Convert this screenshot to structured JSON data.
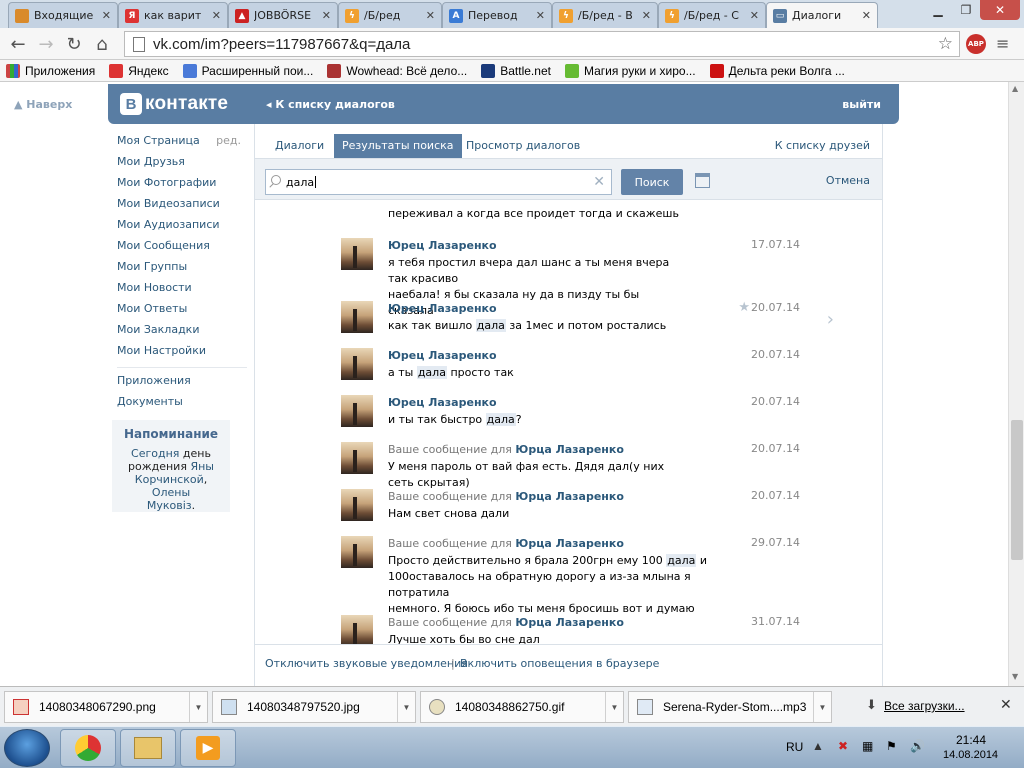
{
  "browser": {
    "tabs": [
      {
        "label": "Входящие",
        "color": "#d98a2b"
      },
      {
        "label": "как варит",
        "color": "#d33"
      },
      {
        "label": "JOBBÖRSE",
        "color": "#c22"
      },
      {
        "label": "/Б/ред",
        "color": "#f0a030"
      },
      {
        "label": "Перевод",
        "color": "#3a7bd5"
      },
      {
        "label": "/Б/ред - В",
        "color": "#f0a030"
      },
      {
        "label": "/Б/ред - С",
        "color": "#f0a030"
      },
      {
        "label": "Диалоги",
        "color": "#597da3"
      }
    ],
    "url": "vk.com/im?peers=117987667&q=дала",
    "abp": "ABP",
    "bookmarks": [
      {
        "label": "Приложения",
        "color": "#c44"
      },
      {
        "label": "Яндекс",
        "color": "#d33"
      },
      {
        "label": "Расширенный пои...",
        "color": "#4a7ad8"
      },
      {
        "label": "Wowhead: Всё дело...",
        "color": "#a33"
      },
      {
        "label": "Battle.net",
        "color": "#1a3a7a"
      },
      {
        "label": "Магия руки и хиро...",
        "color": "#6b3"
      },
      {
        "label": "Дельта реки Волга ...",
        "color": "#c11"
      }
    ]
  },
  "vk": {
    "naverh": "Наверх",
    "logo": "контакте",
    "logo_letter": "В",
    "back": "К списку диалогов",
    "logout": "выйти",
    "menu": [
      {
        "label": "Моя Страница",
        "extra": "ред."
      },
      {
        "label": "Мои Друзья"
      },
      {
        "label": "Мои Фотографии"
      },
      {
        "label": "Мои Видеозаписи"
      },
      {
        "label": "Мои Аудиозаписи"
      },
      {
        "label": "Мои Сообщения"
      },
      {
        "label": "Мои Группы"
      },
      {
        "label": "Мои Новости"
      },
      {
        "label": "Мои Ответы"
      },
      {
        "label": "Мои Закладки"
      },
      {
        "label": "Мои Настройки"
      }
    ],
    "menu2": [
      {
        "label": "Приложения"
      },
      {
        "label": "Документы"
      }
    ],
    "reminder": {
      "title": "Напоминание",
      "today": "Сегодня",
      "text1": "день",
      "text2": "рождения",
      "name1a": "Яны",
      "name1b": "Корчинской",
      "sep": ",",
      "name2a": "Олены",
      "name2b": "Муковіз",
      "end": "."
    },
    "tabs": [
      "Диалоги",
      "Результаты поиска",
      "Просмотр диалогов"
    ],
    "friends_link": "К списку друзей",
    "search_value": "дала",
    "search_button": "Поиск",
    "cancel": "Отмена",
    "top_cut_text": "переживал а когда все пройдет тогда и скажешь",
    "messages": [
      {
        "author": "Юрец Лазаренко",
        "date": "17.07.14",
        "lines": [
          "я тебя простил вчера дал шанс а ты меня вчера так красиво",
          "наебала! я бы сказала ну да в пизду ты бы сказала"
        ]
      },
      {
        "author": "Юрец Лазаренко",
        "date": "20.07.14",
        "pre": "как так вишло ",
        "hl": "дала",
        "post": " за 1мес и потом ростались"
      },
      {
        "author": "Юрец Лазаренко",
        "date": "20.07.14",
        "pre": "а ты ",
        "hl": "дала",
        "post": " просто так"
      },
      {
        "author": "Юрец Лазаренко",
        "date": "20.07.14",
        "pre": "и ты так быстро ",
        "hl": "дала",
        "post": "?"
      },
      {
        "yours": "Ваше сообщение для",
        "to": "Юрца Лазаренко",
        "date": "20.07.14",
        "text": "У меня пароль от вай фая есть. Дядя дал(у них сеть скрытая)"
      },
      {
        "yours": "Ваше сообщение для",
        "to": "Юрца Лазаренко",
        "date": "20.07.14",
        "text": "Нам свет снова дали"
      },
      {
        "yours": "Ваше сообщение для",
        "to": "Юрца Лазаренко",
        "date": "29.07.14",
        "pre": "Просто действительно я брала 200грн ему 100 ",
        "hl": "дала",
        "post": " и",
        "line2": "100оставалось на обратную дорогу а из-за млына я потратила",
        "line3": "немного. Я боюсь ибо ты меня бросишь вот и думаю"
      },
      {
        "yours": "Ваше сообщение для",
        "to": "Юрца Лазаренко",
        "date": "31.07.14",
        "text": "Лучше хоть бы во сне дал"
      }
    ],
    "footer_sound": "Отключить звуковые уведомления",
    "footer_sep": "|",
    "footer_notify": "Включить оповещения в браузере"
  },
  "downloads": {
    "items": [
      "14080348067290.png",
      "14080348797520.jpg",
      "14080348862750.gif",
      "Serena-Ryder-Stom....mp3"
    ],
    "all": "Все загрузки..."
  },
  "taskbar": {
    "lang": "RU",
    "time": "21:44",
    "date": "14.08.2014"
  }
}
